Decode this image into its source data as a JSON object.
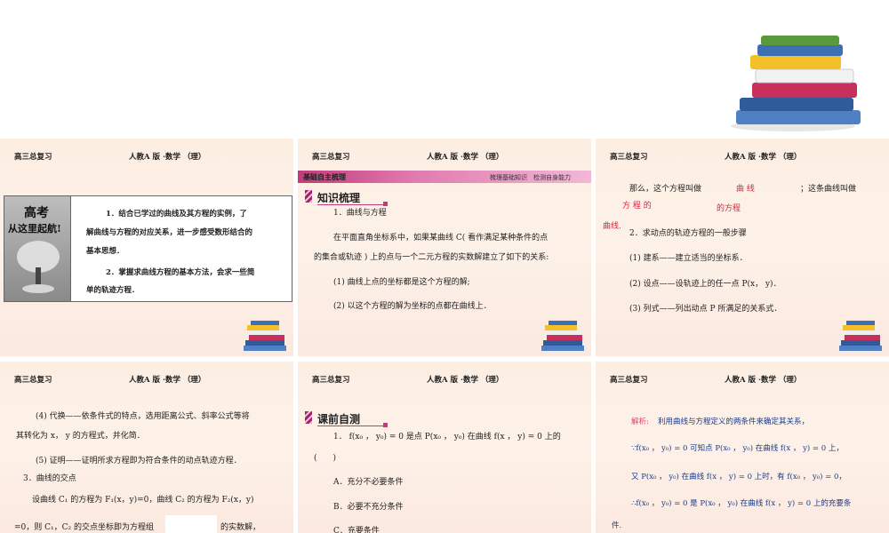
{
  "header": {
    "left": "高三总复习",
    "right": "人教A 版 ·数学 （理）"
  },
  "s1": {
    "badge_line1": "高考",
    "badge_line2": "从这里起航!",
    "goal1_a": "1．结合已学过的曲线及其方程的实例，了",
    "goal1_b": "解曲线与方程的对应关系，进一步感受数形结合的",
    "goal1_c": "基本思想．",
    "goal2_a": "2．掌握求曲线方程的基本方法，会求一些简",
    "goal2_b": "单的轨迹方程．"
  },
  "s2": {
    "ribbon_left": "基础自主梳理",
    "ribbon_right": "梳理基础知识　检测自身能力",
    "tag": "知识梳理",
    "l1": "1．曲线与方程",
    "l2": "在平面直角坐标系中，如果某曲线 C( 看作满足某种条件的点",
    "l3": "的集合或轨迹 ) 上的点与一个二元方程的实数解建立了如下的关系:",
    "l4": "(1) 曲线上点的坐标都是这个方程的解;",
    "l5": "(2) 以这个方程的解为坐标的点都在曲线上．"
  },
  "s3": {
    "l1a": "那么，这个方程叫做",
    "l1b": "曲 线",
    "l1c": "；这条曲线叫做",
    "l2a": "方 程 的",
    "l2b": "的方程",
    "l3a": "曲线.",
    "l3b": "2．求动点的轨迹方程的一般步骤",
    "l4": "(1) 建系——建立适当的坐标系．",
    "l5": "(2) 设点——设轨迹上的任一点 P(x， y)．",
    "l6": "(3) 列式——列出动点 P 所满足的关系式．"
  },
  "s4": {
    "l1": "(4) 代换——依条件式的特点，选用距离公式、斜率公式等将",
    "l2": "其转化为 x， y 的方程式，并化简．",
    "l3": "(5) 证明——证明所求方程即为符合条件的动点轨迹方程．",
    "l4": "3．曲线的交点",
    "l5": "设曲线 C₁ 的方程为 F₁(x，y)=0，曲线 C₂ 的方程为 F₂(x，y)",
    "l6a": "=0，则 C₁，C₂ 的交点坐标即为方程组",
    "l6b": "的实数解，"
  },
  "s5": {
    "tag": "课前自测",
    "q1": "1． f(x₀ ， y₀) = 0 是点 P(x₀ ， y₀) 在曲线 f(x ， y) = 0 上的",
    "q1b": "(　　)",
    "a": "A．充分不必要条件",
    "b": "B．必要不充分条件",
    "c": "C．充要条件"
  },
  "s6": {
    "l1a": "解析:",
    "l1b": "利用曲线与方程定义的两条件来确定其关系，",
    "l2": "∵f(x₀ ， y₀) = 0 可知点 P(x₀ ， y₀) 在曲线 f(x ， y) = 0 上，",
    "l3": "又 P(x₀ ， y₀) 在曲线 f(x ， y) = 0 上时，有 f(x₀ ， y₀) = 0，",
    "l4": "∴f(x₀ ， y₀) = 0 是 P(x₀ ， y₀) 在曲线 f(x ， y) = 0 上的充要条",
    "l5": "件."
  }
}
